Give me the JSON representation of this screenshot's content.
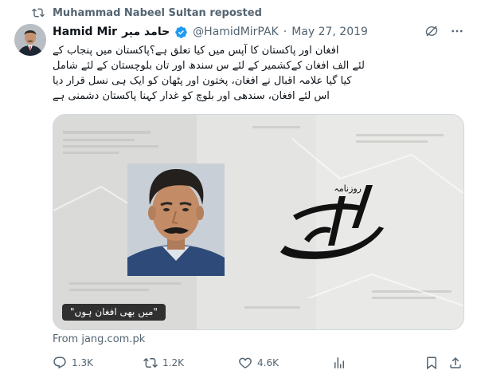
{
  "repost": {
    "text": "Muhammad Nabeel Sultan reposted",
    "icon": "repost-icon"
  },
  "author": {
    "display_name": "Hamid Mir",
    "urdu_name": "حامد میر",
    "handle": "@HamidMirPAK",
    "separator": "·",
    "date": "May 27, 2019",
    "verified_color": "#1d9bf0"
  },
  "tweet": {
    "lines": [
      "افغان اور پاکستان کا آپس میں کیا تعلق ہے؟پاکستان میں پنجاب کے",
      "لئے الف افغان کےکشمیر کے لئے س سندھ اور تان بلوچستان کے لئے شامل",
      "کیا گیا علامہ اقبال نے افغان، پختون اور پٹھان کو ایک ہی نسل قرار دیا",
      "اس لئے افغان، سندھی اور بلوچ کو غدار کہنا پاکستان دشمنی ہے"
    ]
  },
  "card": {
    "caption": "\"میں بھی افغان ہوں\"",
    "logo_text": "جنگ",
    "logo_subtext": "روزنامہ",
    "source": "From jang.com.pk"
  },
  "actions": {
    "replies": "1.3K",
    "reposts": "1.2K",
    "likes": "4.6K"
  },
  "colors": {
    "text_primary": "#0f1419",
    "text_secondary": "#536471",
    "border": "#cfd9de",
    "accent": "#1d9bf0"
  }
}
